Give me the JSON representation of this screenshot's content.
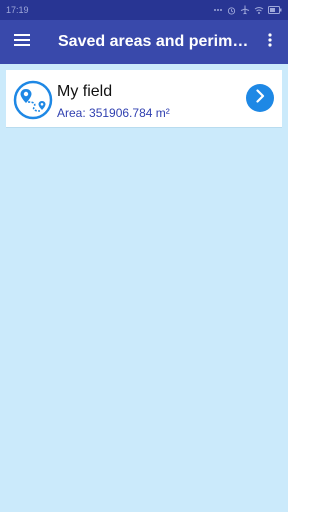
{
  "status_bar": {
    "time": "17:19",
    "icons": [
      "dots-icon",
      "alarm-icon",
      "airplane-icon",
      "wifi-icon",
      "battery-icon"
    ]
  },
  "app_bar": {
    "title": "Saved areas and perimet…",
    "menu_icon": "hamburger-menu-icon",
    "overflow_icon": "more-vert-icon"
  },
  "saved_list": [
    {
      "name": "My field",
      "area": "Area: 351906.784 m²",
      "icon": "map-pin-route-icon",
      "action_icon": "chevron-right-icon"
    }
  ],
  "colors": {
    "status_bar": "#283593",
    "app_bar": "#3949ab",
    "background": "#cbeafb",
    "accent": "#1e88e5",
    "area_text": "#3040b0"
  }
}
